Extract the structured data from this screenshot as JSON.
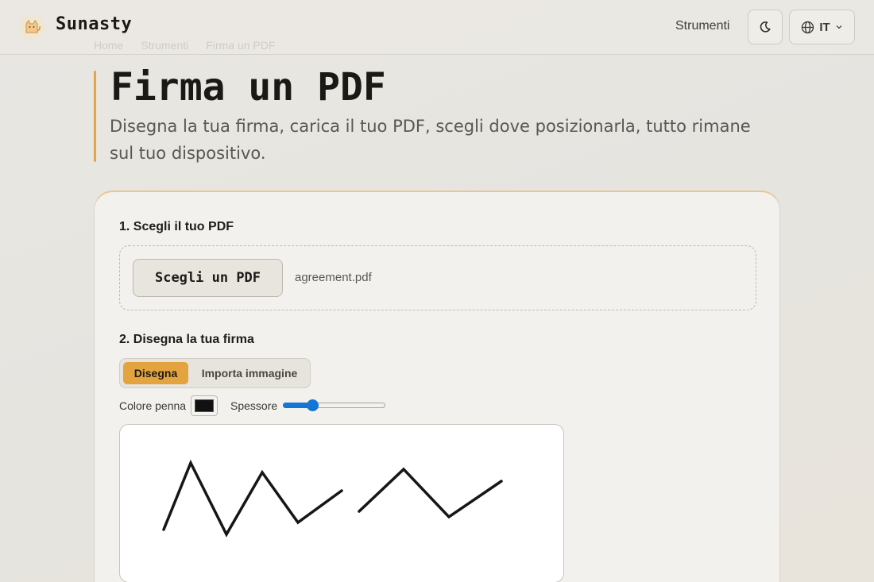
{
  "header": {
    "brand": "Sunasty",
    "nav_link": "Strumenti",
    "lang_code": "IT"
  },
  "breadcrumb": [
    "Home",
    "Strumenti",
    "Firma un PDF"
  ],
  "page": {
    "title": "Firma un PDF",
    "subtitle": "Disegna la tua firma, carica il tuo PDF, scegli dove posizionarla, tutto rimane sul tuo dispositivo."
  },
  "step1": {
    "title": "1. Scegli il tuo PDF",
    "button_label": "Scegli un PDF",
    "filename": "agreement.pdf"
  },
  "step2": {
    "title": "2. Disegna la tua firma",
    "tabs": [
      {
        "label": "Disegna",
        "active": true
      },
      {
        "label": "Importa immagine",
        "active": false
      }
    ],
    "pen_color_label": "Colore penna",
    "pen_color": "#111111",
    "thickness_label": "Spessore",
    "thickness_level": 0.26
  },
  "colors": {
    "accent": "#e3a33e",
    "slider": "#1476d4"
  },
  "icons": {
    "logo": "cat-logo-icon",
    "theme": "moon-icon",
    "language": "globe-icon",
    "dropdown": "chevron-down-icon"
  }
}
